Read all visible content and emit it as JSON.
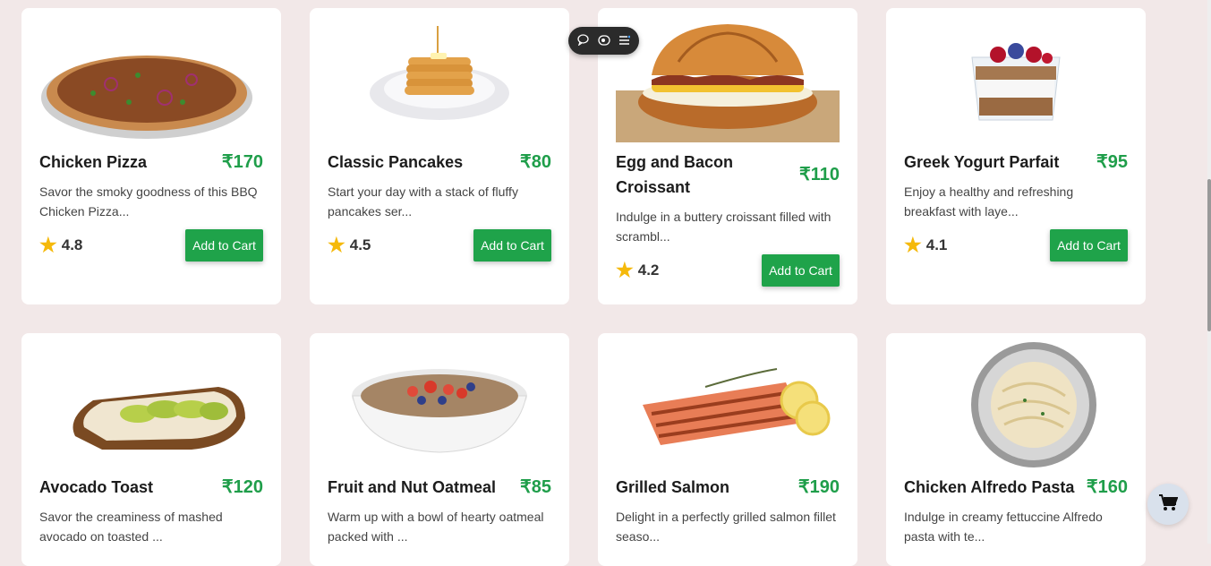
{
  "currency_symbol": "₹",
  "add_to_cart_label": "Add to Cart",
  "colors": {
    "accent": "#1fa34a",
    "price": "#1f9e4a",
    "star": "#f5b90b",
    "background": "#f2e8e8"
  },
  "items": [
    {
      "name": "Chicken Pizza",
      "price": "₹170",
      "description": "Savor the smoky goodness of this BBQ Chicken Pizza...",
      "rating": "4.8",
      "image_icon": "pizza-image"
    },
    {
      "name": "Classic Pancakes",
      "price": "₹80",
      "description": "Start your day with a stack of fluffy pancakes ser...",
      "rating": "4.5",
      "image_icon": "pancakes-image"
    },
    {
      "name": "Egg and Bacon Croissant",
      "price": "₹110",
      "description": "Indulge in a buttery croissant filled with scrambl...",
      "rating": "4.2",
      "image_icon": "croissant-image"
    },
    {
      "name": "Greek Yogurt Parfait",
      "price": "₹95",
      "description": "Enjoy a healthy and refreshing breakfast with laye...",
      "rating": "4.1",
      "image_icon": "parfait-image"
    },
    {
      "name": "Avocado Toast",
      "price": "₹120",
      "description": "Savor the creaminess of mashed avocado on toasted ...",
      "image_icon": "avocado-toast-image"
    },
    {
      "name": "Fruit and Nut Oatmeal",
      "price": "₹85",
      "description": "Warm up with a bowl of hearty oatmeal packed with ...",
      "image_icon": "oatmeal-image"
    },
    {
      "name": "Grilled Salmon",
      "price": "₹190",
      "description": "Delight in a perfectly grilled salmon fillet seaso...",
      "image_icon": "salmon-image"
    },
    {
      "name": "Chicken Alfredo Pasta",
      "price": "₹160",
      "description": "Indulge in creamy fettuccine Alfredo pasta with te...",
      "image_icon": "pasta-image"
    }
  ],
  "toolbar": {
    "icons": [
      "comment-icon",
      "eye-icon",
      "menu-icon"
    ]
  },
  "cart_fab": {
    "icon": "cart-icon"
  }
}
